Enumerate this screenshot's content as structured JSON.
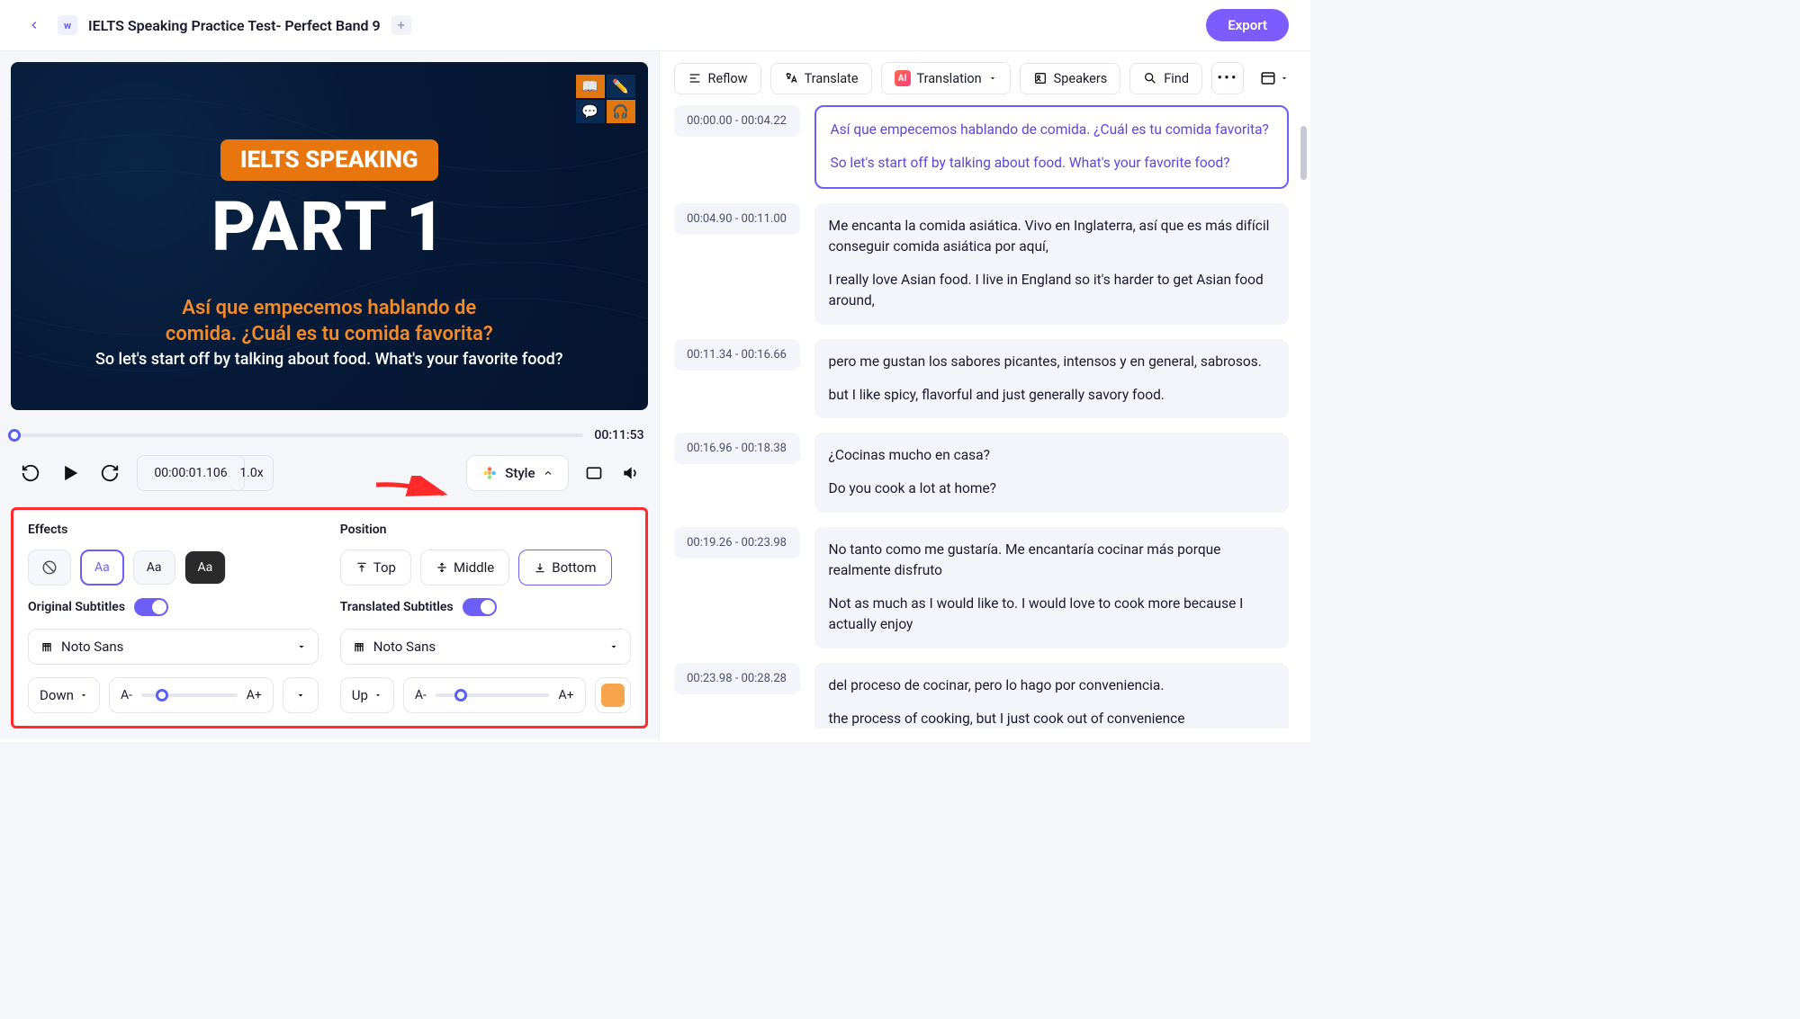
{
  "header": {
    "title": "IELTS Speaking Practice Test- Perfect Band 9",
    "export": "Export"
  },
  "video": {
    "badge": "IELTS SPEAKING",
    "part": "PART 1",
    "sub1_a": "Así que empecemos hablando de",
    "sub1_b": "comida. ¿Cuál es tu comida favorita?",
    "sub2": "So let's start off by talking about food. What's your favorite food?"
  },
  "player": {
    "duration": "00:11:53",
    "time": "00:00:01.106",
    "rate": "1.0x",
    "style": "Style"
  },
  "style": {
    "effects_label": "Effects",
    "position_label": "Position",
    "pos_top": "Top",
    "pos_middle": "Middle",
    "pos_bottom": "Bottom",
    "orig_label": "Original Subtitles",
    "trans_label": "Translated Subtitles",
    "font": "Noto Sans",
    "dir_down": "Down",
    "dir_up": "Up",
    "a_minus": "A-",
    "a_plus": "A+",
    "aa": "Aa",
    "color_orig_none": "white",
    "color_trans": "#f7a44a"
  },
  "toolbar": {
    "reflow": "Reflow",
    "translate": "Translate",
    "translation": "Translation",
    "speakers": "Speakers",
    "find": "Find"
  },
  "segments": [
    {
      "tc": "00:00.00 - 00:04.22",
      "t1": "Así que empecemos hablando de comida. ¿Cuál es tu comida favorita?",
      "t2": "So let's start off by talking about food. What's your favorite food?",
      "active": true
    },
    {
      "tc": "00:04.90 - 00:11.00",
      "t1": "Me encanta la comida asiática. Vivo en Inglaterra, así que es más difícil conseguir comida asiática por aquí,",
      "t2": "I really love Asian food. I live in England so it's harder to get Asian food around,"
    },
    {
      "tc": "00:11.34 - 00:16.66",
      "t1": "pero me gustan los sabores picantes, intensos y en general, sabrosos.",
      "t2": "but I like spicy, flavorful and just generally savory food."
    },
    {
      "tc": "00:16.96 - 00:18.38",
      "t1": "¿Cocinas mucho en casa?",
      "t2": "Do you cook a lot at home?"
    },
    {
      "tc": "00:19.26 - 00:23.98",
      "t1": "No tanto como me gustaría. Me encantaría cocinar más porque realmente disfruto",
      "t2": "Not as much as I would like to. I would love to cook more because I actually enjoy"
    },
    {
      "tc": "00:23.98 - 00:28.28",
      "t1": "del proceso de cocinar, pero lo hago por conveniencia.",
      "t2": "the process of cooking, but I just cook out of convenience"
    }
  ]
}
